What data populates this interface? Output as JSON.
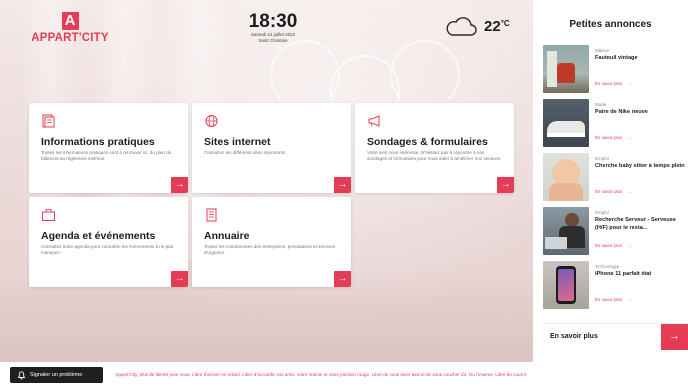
{
  "brand": {
    "logo_letter": "A",
    "name": "APPART'CITY",
    "accent": "#e53c56"
  },
  "clock": {
    "time": "18:30",
    "date": "Samedi 21 juillet 2022",
    "saint": "Saint Christine"
  },
  "weather": {
    "icon": "cloud-icon",
    "temperature": "22",
    "unit": "°C"
  },
  "cards": [
    {
      "icon": "document-icon",
      "title": "Informations pratiques",
      "description": "Toutes les informations pratiques sont à retrouver ici, du plan du bâtiment au règlement intérieur.",
      "arrow": "→"
    },
    {
      "icon": "globe-icon",
      "title": "Sites internet",
      "description": "Consultez les différents sites importants.",
      "arrow": "→"
    },
    {
      "icon": "megaphone-icon",
      "title": "Sondages & formulaires",
      "description": "Votre avis nous intéresse. N'hésitez pas à répondre à nos sondages et formulaires pour nous aider à améliorer nos services.",
      "arrow": "→"
    },
    {
      "icon": "briefcase-icon",
      "title": "Agenda et événements",
      "description": "Consultez notre agenda pour connaître les événements à ne pas manquer !",
      "arrow": "→"
    },
    {
      "icon": "address-book-icon",
      "title": "Annuaire",
      "description": "Toutes les coordonnées des entreprises, prestataires et services d'urgence.",
      "arrow": "→"
    }
  ],
  "ads": {
    "title": "Petites annonces",
    "items": [
      {
        "category": "Maison",
        "title": "Fauteuil vintage",
        "more": "En savoir plus",
        "thumb": "armchair-photo"
      },
      {
        "category": "Mode",
        "title": "Paire de Nike neuve",
        "more": "En savoir plus",
        "thumb": "sneakers-photo"
      },
      {
        "category": "Emploi",
        "title": "Cherche baby sitter à temps plein",
        "more": "En savoir plus",
        "thumb": "baby-photo"
      },
      {
        "category": "Emploi",
        "title": "Recherche Serveur - Serveuse (H/F) pour le resta...",
        "more": "En savoir plus",
        "thumb": "person-laptop-photo"
      },
      {
        "category": "Technologie",
        "title": "iPhone 11 parfait état",
        "more": "En savoir plus",
        "thumb": "phone-photo"
      }
    ],
    "see_more": "En savoir plus",
    "see_more_arrow": "→"
  },
  "footer": {
    "report_label": "Signaler un problème",
    "ticker": "Appart'City, plus de liberté pour vous. Libre d'arriver en retard. Libre d'accueillir vos amis, votre mamie et votre poisson rouge. Libre de vous lever tard et de vous coucher tôt. Ou l'inverse. Libre de vous tr"
  }
}
